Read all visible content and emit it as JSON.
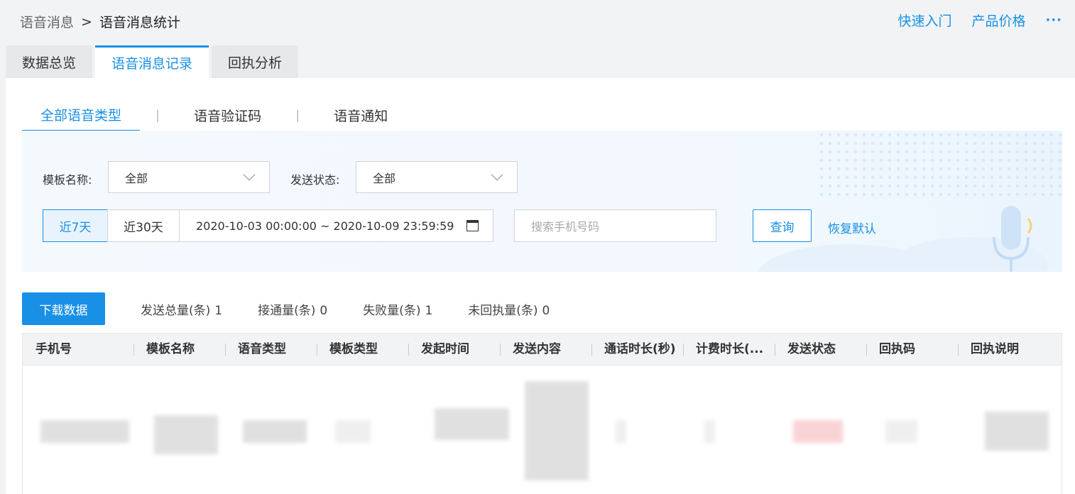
{
  "breadcrumb": {
    "parent": "语音消息",
    "separator": ">",
    "current": "语音消息统计"
  },
  "top_links": {
    "quick_start": "快速入门",
    "pricing": "产品价格",
    "more": "···"
  },
  "tabs": [
    {
      "label": "数据总览",
      "active": false
    },
    {
      "label": "语音消息记录",
      "active": true
    },
    {
      "label": "回执分析",
      "active": false
    }
  ],
  "subtabs": [
    {
      "label": "全部语音类型",
      "active": true
    },
    {
      "label": "语音验证码",
      "active": false
    },
    {
      "label": "语音通知",
      "active": false
    }
  ],
  "filters": {
    "template_label": "模板名称:",
    "template_value": "全部",
    "status_label": "发送状态:",
    "status_value": "全部",
    "day7": "近7天",
    "day30": "近30天",
    "date_range": "2020-10-03 00:00:00 ~ 2020-10-09 23:59:59",
    "search_placeholder": "搜索手机号码",
    "query_button": "查询",
    "reset_link": "恢复默认"
  },
  "actions": {
    "download": "下载数据"
  },
  "stats": [
    {
      "label": "发送总量(条)",
      "value": "1"
    },
    {
      "label": "接通量(条)",
      "value": "0"
    },
    {
      "label": "失败量(条)",
      "value": "1"
    },
    {
      "label": "未回执量(条)",
      "value": "0"
    }
  ],
  "table": {
    "columns": [
      "手机号",
      "模板名称",
      "语音类型",
      "模板类型",
      "发起时间",
      "发送内容",
      "通话时长(秒)",
      "计费时长(...",
      "发送状态",
      "回执码",
      "回执说明"
    ]
  },
  "colors": {
    "accent": "#1890e6"
  }
}
